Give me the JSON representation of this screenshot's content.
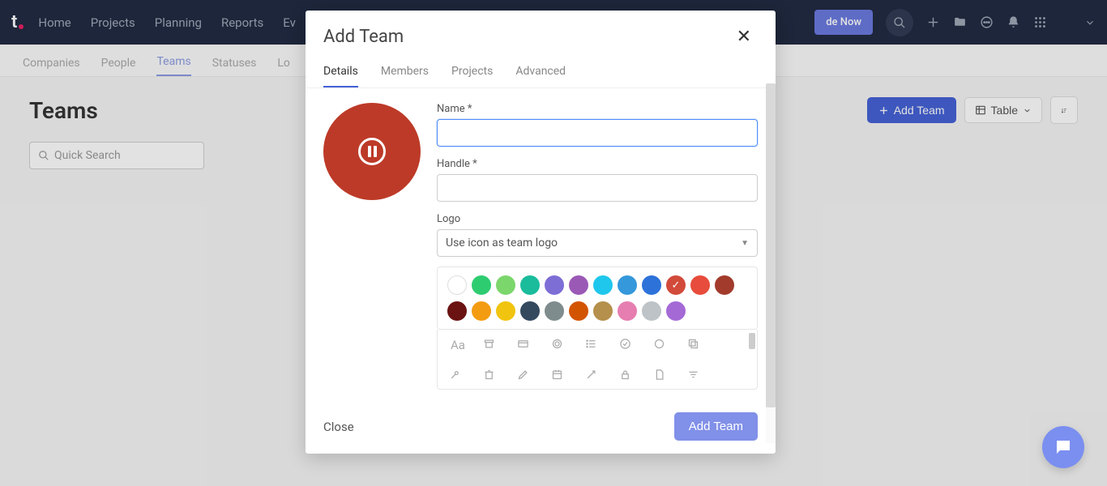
{
  "nav": {
    "items": [
      "Home",
      "Projects",
      "Planning",
      "Reports",
      "Ev"
    ],
    "upgrade": "de Now"
  },
  "subnav": {
    "items": [
      "Companies",
      "People",
      "Teams",
      "Statuses",
      "Lo"
    ],
    "active": "Teams"
  },
  "page": {
    "title": "Teams",
    "searchPlaceholder": "Quick Search",
    "addBtn": "Add Team",
    "viewBtn": "Table"
  },
  "modal": {
    "title": "Add Team",
    "tabs": [
      "Details",
      "Members",
      "Projects",
      "Advanced"
    ],
    "activeTab": "Details",
    "nameLabel": "Name *",
    "nameValue": "",
    "handleLabel": "Handle *",
    "handleValue": "",
    "logoLabel": "Logo",
    "logoSelect": "Use icon as team logo",
    "closeLabel": "Close",
    "submitLabel": "Add Team",
    "colorsRow1": [
      "#ffffff",
      "#2ecc71",
      "#7bd66b",
      "#1abc9c",
      "#7d6ed6",
      "#9b59b6",
      "#1fc7ec",
      "#3498db",
      "#2d72d9",
      "#d24a3a",
      "#e74c3c",
      "#a23b2c"
    ],
    "selectedColorIndex": 9,
    "colorsRow2": [
      "#6b1212",
      "#f39c12",
      "#f1c40f",
      "#34495e",
      "#7f8c8d",
      "#d35400",
      "#b58f4c",
      "#e67eb1",
      "#bdc3c7",
      "#a569d6"
    ]
  }
}
